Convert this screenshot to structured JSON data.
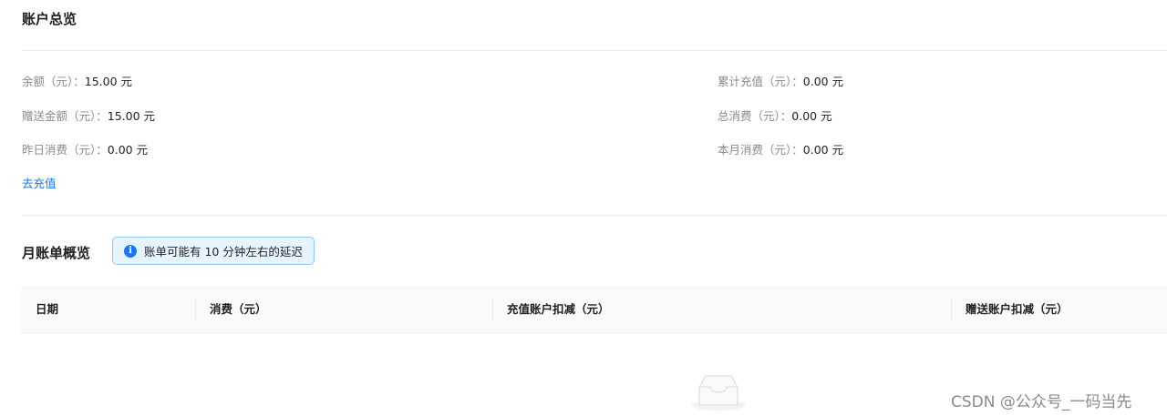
{
  "account": {
    "title": "账户总览",
    "balance": {
      "label": "余额（元）：",
      "value": "15.00 元"
    },
    "gift_amount": {
      "label": "赠送金额（元）：",
      "value": "15.00 元"
    },
    "yesterday_spend": {
      "label": "昨日消费（元）：",
      "value": "0.00 元"
    },
    "total_recharge": {
      "label": "累计充值（元）：",
      "value": "0.00 元"
    },
    "total_spend": {
      "label": "总消费（元）：",
      "value": "0.00 元"
    },
    "month_spend": {
      "label": "本月消费（元）：",
      "value": "0.00 元"
    },
    "recharge_link": "去充值"
  },
  "monthly": {
    "title": "月账单概览",
    "notice": "账单可能有 10 分钟左右的延迟",
    "notice_icon": "info-icon",
    "columns": [
      "日期",
      "消费（元）",
      "充值账户扣减（元）",
      "赠送账户扣减（元）"
    ],
    "empty_icon": "empty-box-icon"
  },
  "watermark": "CSDN @公众号_一码当先",
  "colors": {
    "link": "#1677ff",
    "notice_bg": "#e6f4ff",
    "notice_border": "#91caff"
  }
}
